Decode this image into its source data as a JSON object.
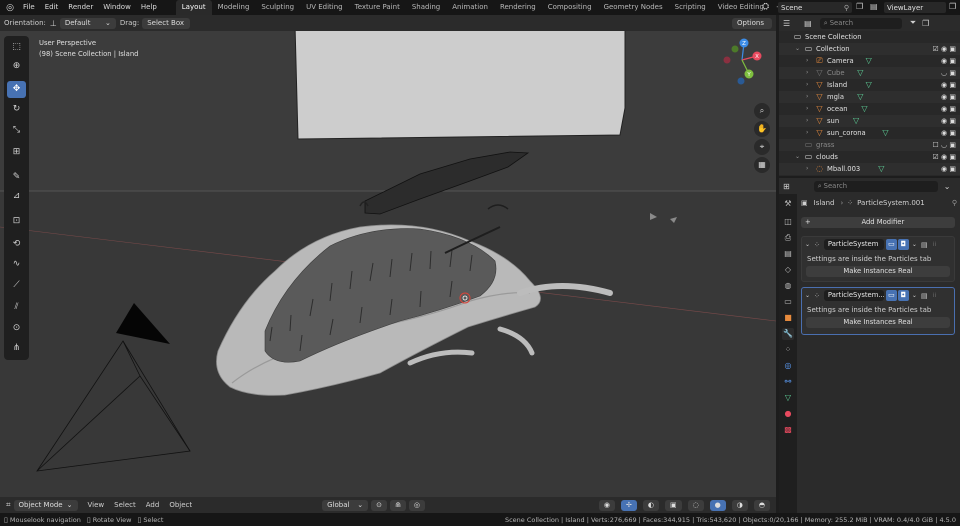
{
  "topbar": {
    "menus": [
      "File",
      "Edit",
      "Render",
      "Window",
      "Help"
    ],
    "workspace_tabs": [
      "Layout",
      "Modeling",
      "Sculpting",
      "UV Editing",
      "Texture Paint",
      "Shading",
      "Animation",
      "Rendering",
      "Compositing",
      "Geometry Nodes",
      "Scripting",
      "Video Editing"
    ],
    "active_tab": "Layout",
    "add_tab": "+",
    "scene": "Scene",
    "view_layer": "ViewLayer"
  },
  "viewport_header": {
    "orientation_label": "Orientation:",
    "orientation_value": "Default",
    "drag_label": "Drag:",
    "drag_value": "Select Box",
    "options_label": "Options"
  },
  "viewport": {
    "perspective_text": "User Perspective",
    "collection_text": "(98) Scene Collection | Island",
    "gizmo": {
      "x": "X",
      "y": "Y",
      "z": "Z"
    }
  },
  "viewport_footer": {
    "mode": "Object Mode",
    "menus": [
      "View",
      "Select",
      "Add",
      "Object"
    ],
    "transform_orientation": "Global"
  },
  "statusbar": {
    "hints": [
      "Mouselook navigation",
      "Rotate View",
      "Select"
    ],
    "stats": "Scene Collection | Island | Verts:276,669 | Faces:344,915 | Tris:543,620 | Objects:0/20,166 | Memory: 255.2 MiB | VRAM: 0.4/4.0 GiB | 4.5.0"
  },
  "outliner": {
    "search_placeholder": "Search",
    "rows": [
      {
        "label": "Scene Collection",
        "indent": 0,
        "icon": "scene-collection-icon",
        "twisty": "",
        "type": "root"
      },
      {
        "label": "Collection",
        "indent": 1,
        "icon": "collection-icon",
        "twisty": "open",
        "type": "collection"
      },
      {
        "label": "Camera",
        "indent": 2,
        "icon": "camera-object-icon",
        "twisty": "closed",
        "type": "object"
      },
      {
        "label": "Cube",
        "indent": 2,
        "icon": "mesh-object-icon",
        "twisty": "closed",
        "type": "object",
        "dim": true
      },
      {
        "label": "Island",
        "indent": 2,
        "icon": "mesh-object-icon",
        "twisty": "closed",
        "type": "object"
      },
      {
        "label": "mgla",
        "indent": 2,
        "icon": "mesh-object-icon",
        "twisty": "closed",
        "type": "object"
      },
      {
        "label": "ocean",
        "indent": 2,
        "icon": "mesh-object-icon",
        "twisty": "closed",
        "type": "object"
      },
      {
        "label": "sun",
        "indent": 2,
        "icon": "mesh-object-icon",
        "twisty": "closed",
        "type": "object"
      },
      {
        "label": "sun_corona",
        "indent": 2,
        "icon": "mesh-object-icon",
        "twisty": "closed",
        "type": "object"
      },
      {
        "label": "grass",
        "indent": 1,
        "icon": "collection-icon",
        "twisty": "",
        "type": "collection",
        "dim": true
      },
      {
        "label": "clouds",
        "indent": 1,
        "icon": "collection-icon",
        "twisty": "open",
        "type": "collection"
      },
      {
        "label": "Mball.003",
        "indent": 2,
        "icon": "metaball-object-icon",
        "twisty": "closed",
        "type": "object"
      }
    ]
  },
  "properties": {
    "search_placeholder": "Search",
    "breadcrumb_object": "Island",
    "breadcrumb_modifier": "ParticleSystem.001",
    "add_modifier": "Add Modifier",
    "modifiers": [
      {
        "name": "ParticleSystem",
        "info": "Settings are inside the Particles tab",
        "button": "Make Instances Real"
      },
      {
        "name": "ParticleSystem...",
        "info": "Settings are inside the Particles tab",
        "button": "Make Instances Real"
      }
    ]
  },
  "colors": {
    "accent_blue": "#4772b3",
    "mesh_orange": "#e88b3d",
    "data_green": "#5fd39a",
    "gizmo_x": "#e84a5f",
    "gizmo_y": "#7fbf3f",
    "gizmo_z": "#3c8ce6"
  }
}
